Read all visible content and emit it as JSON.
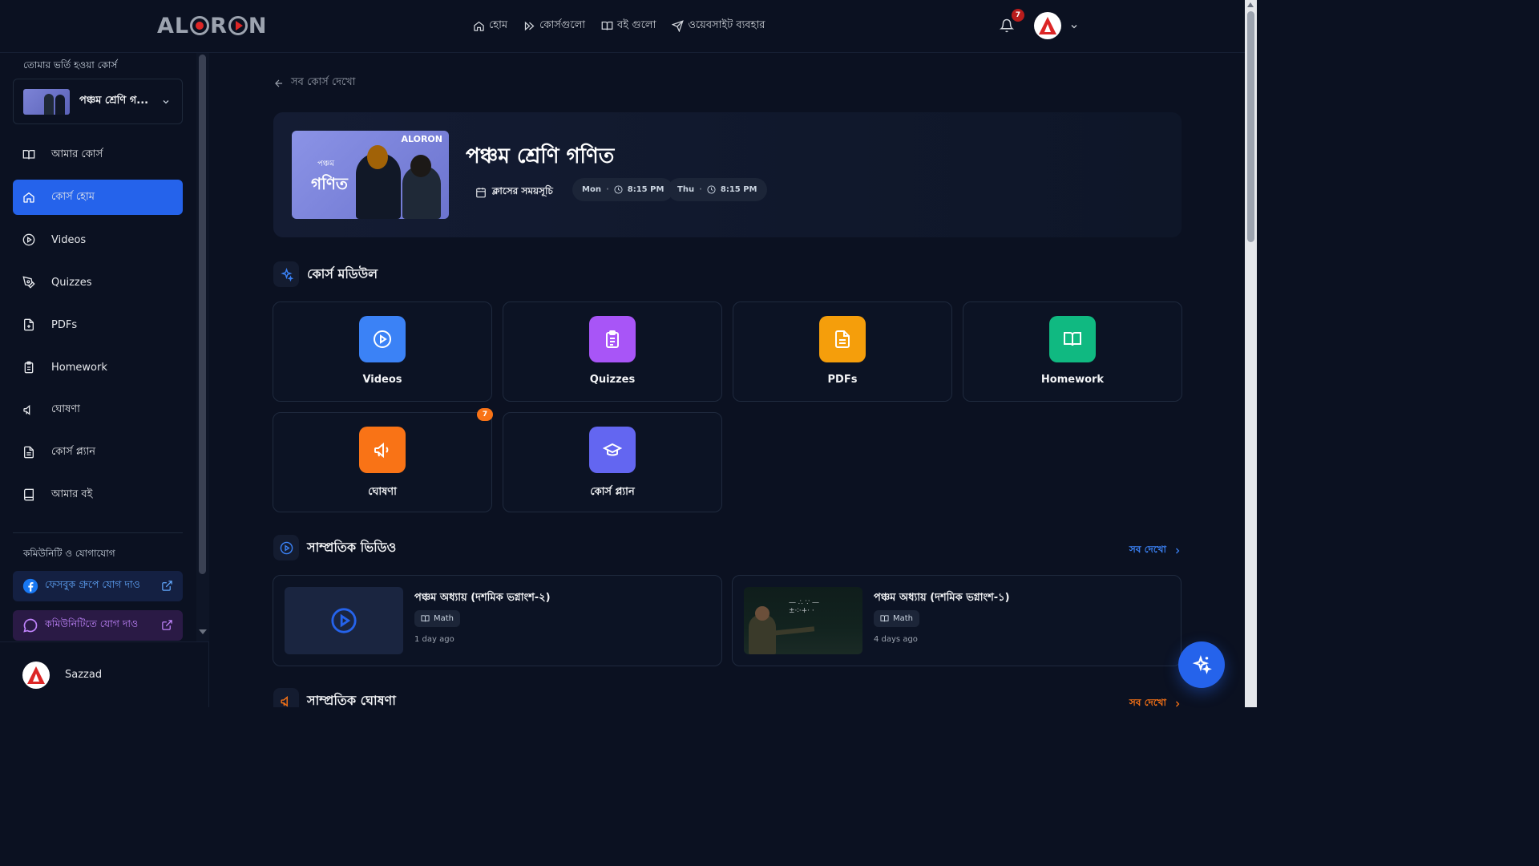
{
  "header": {
    "logo": "ALORON",
    "nav": [
      {
        "label": "হোম",
        "icon": "home-icon"
      },
      {
        "label": "কোর্সগুলো",
        "icon": "courses-icon"
      },
      {
        "label": "বই গুলো",
        "icon": "book-icon"
      },
      {
        "label": "ওয়েবসাইট ব্যবহার",
        "icon": "send-icon"
      }
    ],
    "notification_count": "7"
  },
  "sidebar": {
    "enrolled_heading": "তোমার ভর্তি হওয়া কোর্স",
    "selected_course": "পঞ্চম শ্রেণি গ...",
    "items": [
      {
        "label": "আমার কোর্স",
        "icon": "book-open-icon"
      },
      {
        "label": "কোর্স হোম",
        "icon": "home-icon",
        "active": true
      },
      {
        "label": "Videos",
        "icon": "play-circle-icon"
      },
      {
        "label": "Quizzes",
        "icon": "pen-tool-icon"
      },
      {
        "label": "PDFs",
        "icon": "file-icon"
      },
      {
        "label": "Homework",
        "icon": "clipboard-icon"
      },
      {
        "label": "ঘোষণা",
        "icon": "megaphone-icon"
      },
      {
        "label": "কোর্স প্ল্যান",
        "icon": "file-text-icon"
      },
      {
        "label": "আমার বই",
        "icon": "book-icon"
      }
    ],
    "community_heading": "কমিউনিটি ও যোগাযোগ",
    "facebook_link": "ফেসবুক গ্রুপে যোগ দাও",
    "community_link": "কমিউনিটিতে যোগ দাও",
    "user_name": "Sazzad"
  },
  "main": {
    "back_link": "সব কোর্স দেখো",
    "course": {
      "title": "পঞ্চম শ্রেণি গণিত",
      "thumb_brand": "ALORON",
      "thumb_line1": "পঞ্চম",
      "thumb_line2": "গণিত",
      "schedule_label": "ক্লাসের সময়সূচি",
      "schedule": [
        {
          "day": "Mon",
          "time": "8:15 PM"
        },
        {
          "day": "Thu",
          "time": "8:15 PM"
        }
      ]
    },
    "modules_heading": "কোর্স মডিউল",
    "modules": [
      {
        "label": "Videos",
        "color": "#3b82f6",
        "icon": "play-circle-icon"
      },
      {
        "label": "Quizzes",
        "color": "#a855f7",
        "icon": "clipboard-icon"
      },
      {
        "label": "PDFs",
        "color": "#f59e0b",
        "icon": "file-text-icon"
      },
      {
        "label": "Homework",
        "color": "#10b981",
        "icon": "book-open-icon"
      },
      {
        "label": "ঘোষণা",
        "color": "#f97316",
        "icon": "megaphone-icon",
        "badge": "7"
      },
      {
        "label": "কোর্স প্ল্যান",
        "color": "#6366f1",
        "icon": "graduation-cap-icon"
      }
    ],
    "recent_videos_heading": "সাম্প্রতিক ভিডিও",
    "see_all": "সব দেখো",
    "videos": [
      {
        "title": "পঞ্চম অধ্যায় (দশমিক ভগ্নাংশ-২)",
        "tag": "Math",
        "time": "1 day ago"
      },
      {
        "title": "পঞ্চম অধ্যায় (দশমিক ভগ্নাংশ-১)",
        "tag": "Math",
        "time": "4 days ago"
      }
    ],
    "recent_announcements_heading": "সাম্প্রতিক ঘোষণা"
  },
  "colors": {
    "accent": "#2563eb",
    "background": "#0b1121"
  }
}
